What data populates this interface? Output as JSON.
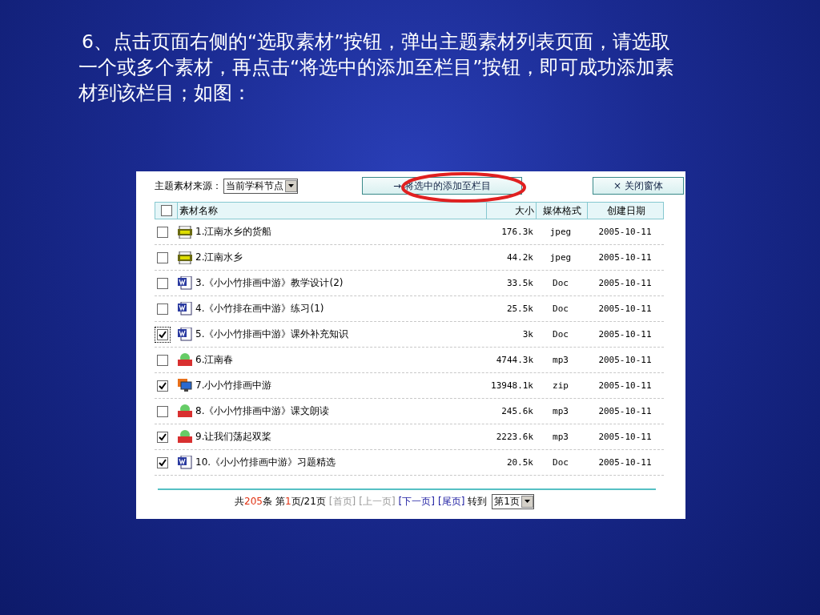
{
  "instruction": "6、点击页面右侧的“选取素材”按钮，弹出主题素材列表页面，请选取一个或多个素材，再点击“将选中的添加至栏目”按钮，即可成功添加素材到该栏目；如图：",
  "source": {
    "label": "主题素材来源：",
    "value": "当前学科节点"
  },
  "add_button": {
    "arrow": "→",
    "label": "将选中的添加至栏目",
    "highlighted": true
  },
  "close_button": {
    "symbol": "×",
    "label": "关闭窗体"
  },
  "table": {
    "select_all": {
      "checked": false
    },
    "columns": [
      "素材名称",
      "大小",
      "媒体格式",
      "创建日期"
    ],
    "rows": [
      {
        "checked": false,
        "focused": false,
        "kind": "jpg",
        "name": "1.江南水乡的货船",
        "size": "176.3k",
        "format": "jpeg",
        "date": "2005-10-11"
      },
      {
        "checked": false,
        "focused": false,
        "kind": "jpg",
        "name": "2.江南水乡",
        "size": "44.2k",
        "format": "jpeg",
        "date": "2005-10-11"
      },
      {
        "checked": false,
        "focused": false,
        "kind": "doc",
        "name": "3.《小小竹排画中游》教学设计(2)",
        "size": "33.5k",
        "format": "Doc",
        "date": "2005-10-11"
      },
      {
        "checked": false,
        "focused": false,
        "kind": "doc",
        "name": "4.《小竹排在画中游》练习(1)",
        "size": "25.5k",
        "format": "Doc",
        "date": "2005-10-11"
      },
      {
        "checked": true,
        "focused": true,
        "kind": "doc",
        "name": "5.《小小竹排画中游》课外补充知识",
        "size": "3k",
        "format": "Doc",
        "date": "2005-10-11"
      },
      {
        "checked": false,
        "focused": false,
        "kind": "mp3",
        "name": "6.江南春",
        "size": "4744.3k",
        "format": "mp3",
        "date": "2005-10-11"
      },
      {
        "checked": true,
        "focused": false,
        "kind": "zip",
        "name": "7.小小竹排画中游",
        "size": "13948.1k",
        "format": "zip",
        "date": "2005-10-11"
      },
      {
        "checked": false,
        "focused": false,
        "kind": "mp3",
        "name": "8.《小小竹排画中游》课文朗读",
        "size": "245.6k",
        "format": "mp3",
        "date": "2005-10-11"
      },
      {
        "checked": true,
        "focused": false,
        "kind": "mp3",
        "name": "9.让我们荡起双桨",
        "size": "2223.6k",
        "format": "mp3",
        "date": "2005-10-11"
      },
      {
        "checked": true,
        "focused": false,
        "kind": "doc",
        "name": "10.《小小竹排画中游》习题精选",
        "size": "20.5k",
        "format": "Doc",
        "date": "2005-10-11"
      }
    ]
  },
  "pager": {
    "total_prefix": "共",
    "total": "205",
    "total_suffix": "条",
    "page_prefix": "第",
    "page": "1",
    "page_suffix": "页/21页",
    "links": [
      {
        "label": "[首页]",
        "disabled": true
      },
      {
        "label": "[上一页]",
        "disabled": true
      },
      {
        "label": "[下一页]",
        "disabled": false
      },
      {
        "label": "[尾页]",
        "disabled": false
      }
    ],
    "goto_label": "转到",
    "goto_value": "第1页"
  }
}
